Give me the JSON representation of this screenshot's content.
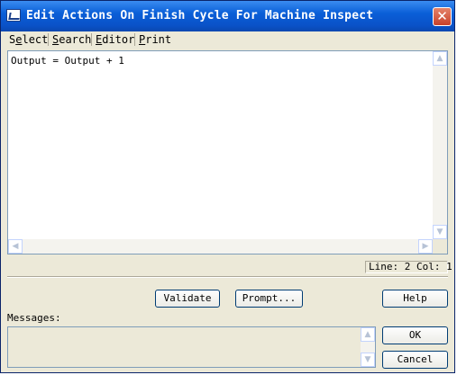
{
  "window": {
    "title": "Edit Actions On Finish Cycle For Machine Inspect",
    "close_glyph": "✕"
  },
  "menu": {
    "items": [
      {
        "label": "Select",
        "mnemonic": "e"
      },
      {
        "label": "Search",
        "mnemonic": "S"
      },
      {
        "label": "Editor",
        "mnemonic": "E"
      },
      {
        "label": "Print",
        "mnemonic": "P"
      }
    ]
  },
  "editor": {
    "content": "Output = Output + 1"
  },
  "status": {
    "text": "Line: 2 Col: 1"
  },
  "buttons": {
    "validate": "Validate",
    "prompt": "Prompt...",
    "help": "Help",
    "ok": "OK",
    "cancel": "Cancel"
  },
  "messages": {
    "label": "Messages:",
    "content": ""
  },
  "icons": {
    "scroll_up": "up-arrow-icon",
    "scroll_down": "down-arrow-icon",
    "scroll_left": "left-arrow-icon",
    "scroll_right": "right-arrow-icon"
  }
}
